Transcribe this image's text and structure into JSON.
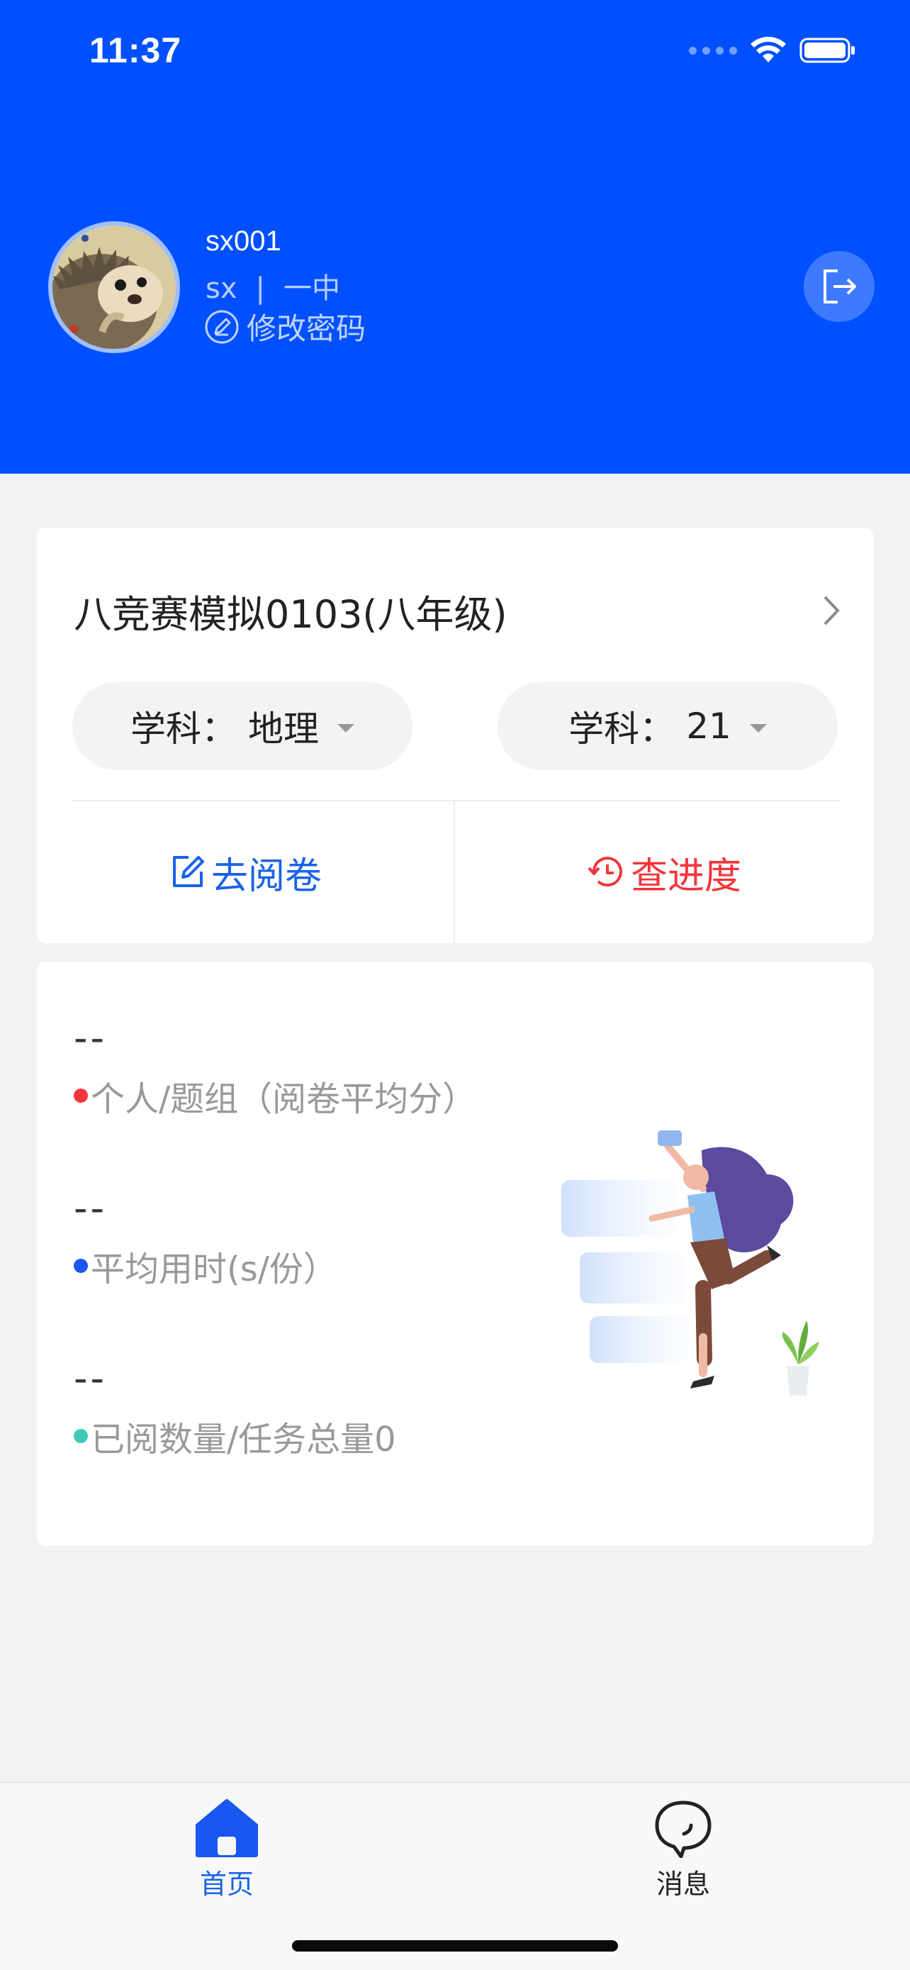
{
  "status_bar": {
    "time": "11:37"
  },
  "profile": {
    "username": "sx001",
    "role": "sx",
    "separator": "|",
    "school": "一中",
    "change_password_label": "修改密码"
  },
  "task": {
    "title": "八竞赛模拟0103(八年级)",
    "subject_selector": {
      "label": "学科：",
      "value": "地理"
    },
    "question_selector": {
      "label": "学科：",
      "value": "21"
    },
    "review_label": "去阅卷",
    "progress_label": "查进度"
  },
  "stats": [
    {
      "value": "--",
      "label": "个人/题组（阅卷平均分）",
      "dot_color": "#f2353a"
    },
    {
      "value": "--",
      "label": "平均用时(s/份）",
      "dot_color": "#1a56f0"
    },
    {
      "value": "--",
      "label": "已阅数量/任务总量0",
      "dot_color": "#3ec9b8"
    }
  ],
  "tabbar": {
    "home_label": "首页",
    "messages_label": "消息"
  },
  "colors": {
    "header_blue": "#0050ff",
    "accent_blue": "#1a62e8",
    "accent_red": "#f2353a"
  }
}
